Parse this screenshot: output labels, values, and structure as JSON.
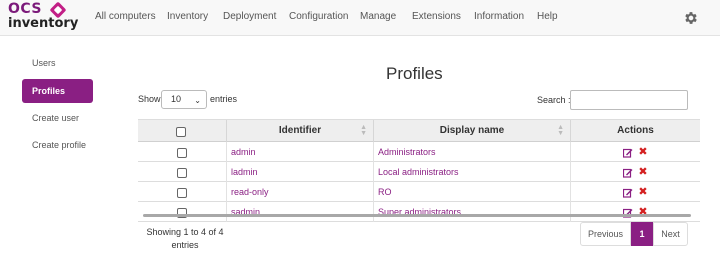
{
  "logo": {
    "top": "OCS",
    "bottom": "inventory"
  },
  "nav": [
    "All computers",
    "Inventory",
    "Deployment",
    "Configuration",
    "Manage",
    "Extensions",
    "Information",
    "Help"
  ],
  "settings_icon": "gear-icon",
  "sidebar": [
    "Users",
    "Profiles",
    "Create user",
    "Create profile"
  ],
  "sidebar_active": "Profiles",
  "page_title": "Profiles",
  "controls": {
    "show_label": "Show",
    "show_value": "10",
    "entries_label": "entries",
    "search_label": "Search :",
    "search_value": ""
  },
  "table": {
    "headers": [
      "",
      "Identifier",
      "Display name",
      "Actions"
    ],
    "rows": [
      {
        "identifier": "admin",
        "display_name": "Administrators"
      },
      {
        "identifier": "ladmin",
        "display_name": "Local administrators"
      },
      {
        "identifier": "read-only",
        "display_name": "RO"
      },
      {
        "identifier": "sadmin",
        "display_name": "Super administrators"
      }
    ]
  },
  "footer": {
    "info": "Showing 1 to 4 of 4 entries",
    "previous": "Previous",
    "current_page": "1",
    "next": "Next"
  },
  "colors": {
    "accent": "#8a1f83",
    "delete": "#d42020"
  }
}
